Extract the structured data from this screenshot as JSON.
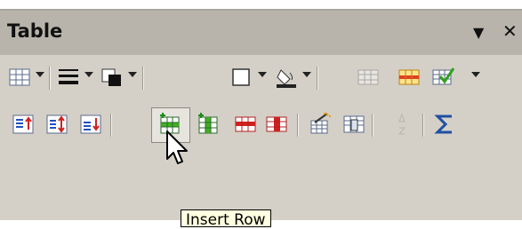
{
  "panel": {
    "title": "Table",
    "menu_glyph": "▼",
    "close_glyph": "✕"
  },
  "toolbar_row1": [
    {
      "name": "table-icon",
      "dropdown": true
    },
    {
      "name": "border-style-icon",
      "dropdown": true
    },
    {
      "name": "border-color-icon",
      "dropdown": true
    },
    {
      "name": "borders-icon",
      "dropdown": true
    },
    {
      "name": "fill-color-icon",
      "dropdown": true
    },
    {
      "name": "merge-cells-icon",
      "disabled": true
    },
    {
      "name": "split-cells-icon"
    },
    {
      "name": "optimize-icon",
      "dropdown": true
    }
  ],
  "toolbar_row2": [
    {
      "name": "align-top-icon"
    },
    {
      "name": "align-center-icon"
    },
    {
      "name": "align-bottom-icon"
    },
    {
      "name": "insert-row-icon",
      "hovered": true
    },
    {
      "name": "insert-column-icon"
    },
    {
      "name": "delete-row-icon"
    },
    {
      "name": "delete-column-icon"
    },
    {
      "name": "autoformat-icon"
    },
    {
      "name": "table-properties-icon"
    },
    {
      "name": "sort-icon",
      "disabled": true
    },
    {
      "name": "sum-icon"
    }
  ],
  "tooltip": {
    "text": "Insert Row"
  },
  "colors": {
    "panel_bg": "#d4d0c8",
    "titlebar_bg": "#b8b4ac",
    "icon_blue": "#2050c0",
    "icon_green": "#40a020",
    "icon_red": "#d02020"
  }
}
